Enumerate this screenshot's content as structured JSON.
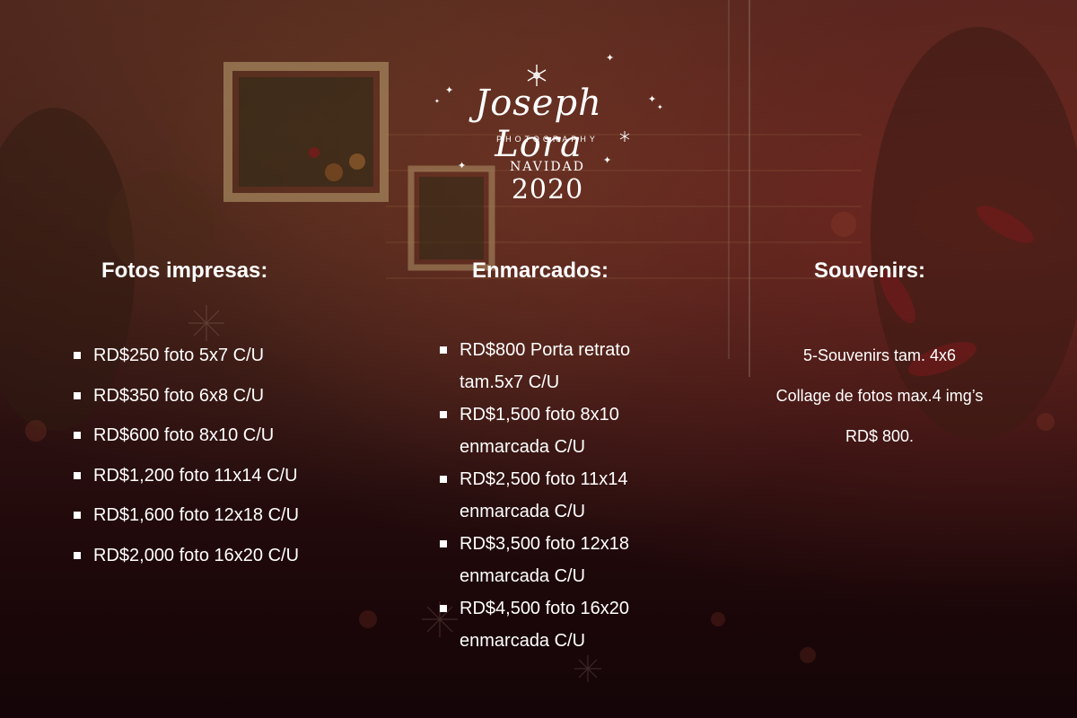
{
  "brand": {
    "name": "Joseph Lora",
    "subtitle": "PHOTOGRAPHY",
    "season": "NAVIDAD",
    "year": "2020"
  },
  "columns": [
    {
      "heading": "Fotos impresas:",
      "items": [
        "RD$250 foto 5x7 C/U",
        "RD$350 foto 6x8 C/U",
        "RD$600 foto 8x10 C/U",
        "RD$1,200 foto 11x14 C/U",
        "RD$1,600 foto 12x18 C/U",
        "RD$2,000 foto 16x20 C/U"
      ]
    },
    {
      "heading": "Enmarcados:",
      "items": [
        {
          "line1": "RD$800 Porta retrato",
          "line2": "tam.5x7 C/U"
        },
        {
          "line1": "RD$1,500 foto 8x10",
          "line2": "enmarcada C/U"
        },
        {
          "line1": "RD$2,500 foto 11x14",
          "line2": "enmarcada C/U"
        },
        {
          "line1": "RD$3,500 foto 12x18",
          "line2": "enmarcada C/U"
        },
        {
          "line1": "RD$4,500 foto 16x20",
          "line2": "enmarcada C/U"
        }
      ]
    },
    {
      "heading": "Souvenirs:",
      "lines": [
        "5-Souvenirs tam. 4x6",
        "Collage de fotos max.4 img’s",
        "RD$ 800."
      ]
    }
  ],
  "colors": {
    "text": "#ffffff",
    "background_top": "#4a231c",
    "background_bottom": "#150508"
  }
}
